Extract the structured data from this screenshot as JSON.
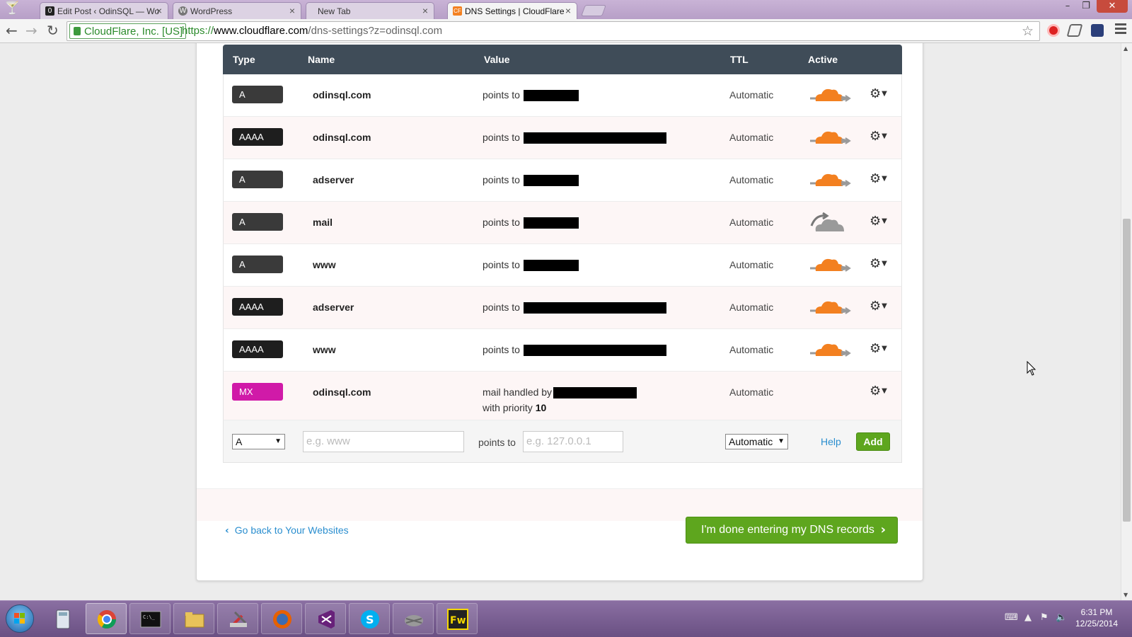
{
  "browser": {
    "tabs": [
      {
        "title": "Edit Post ‹ OdinSQL — Wo",
        "icon": "odinsql-favicon",
        "active": false
      },
      {
        "title": "WordPress",
        "icon": "wordpress-favicon",
        "active": false
      },
      {
        "title": "New Tab",
        "icon": "",
        "active": false
      },
      {
        "title": "DNS Settings | CloudFlare",
        "icon": "cloudflare-favicon",
        "active": true
      }
    ],
    "security_badge": "CloudFlare, Inc. [US]",
    "url": {
      "scheme": "https://",
      "host": "www.cloudflare.com",
      "path": "/dns-settings?z=odinsql.com"
    }
  },
  "dns": {
    "headers": {
      "type": "Type",
      "name": "Name",
      "value": "Value",
      "ttl": "TTL",
      "active": "Active"
    },
    "records": [
      {
        "type": "A",
        "name": "odinsql.com",
        "value_label": "points to",
        "ttl": "Automatic",
        "cloud": "orange",
        "redact_width": 78
      },
      {
        "type": "AAAA",
        "name": "odinsql.com",
        "value_label": "points to",
        "ttl": "Automatic",
        "cloud": "orange",
        "redact_width": 202
      },
      {
        "type": "A",
        "name": "adserver",
        "value_label": "points to",
        "ttl": "Automatic",
        "cloud": "orange",
        "redact_width": 78
      },
      {
        "type": "A",
        "name": "mail",
        "value_label": "points to",
        "ttl": "Automatic",
        "cloud": "grey",
        "redact_width": 78
      },
      {
        "type": "A",
        "name": "www",
        "value_label": "points to",
        "ttl": "Automatic",
        "cloud": "orange",
        "redact_width": 78
      },
      {
        "type": "AAAA",
        "name": "adserver",
        "value_label": "points to",
        "ttl": "Automatic",
        "cloud": "orange",
        "redact_width": 202
      },
      {
        "type": "AAAA",
        "name": "www",
        "value_label": "points to",
        "ttl": "Automatic",
        "cloud": "orange",
        "redact_width": 202
      },
      {
        "type": "MX",
        "name": "odinsql.com",
        "value_label": "mail handled by",
        "value_line2_prefix": "with priority",
        "priority": "10",
        "ttl": "Automatic",
        "cloud": "none",
        "redact_width": 118
      }
    ],
    "type_colors": {
      "A": "#3a3a3a",
      "AAAA": "#1e1e1e",
      "MX": "#d01aa8"
    },
    "add_form": {
      "type_value": "A",
      "name_placeholder": "e.g. www",
      "points_to_label": "points to",
      "value_placeholder": "e.g. 127.0.0.1",
      "ttl_value": "Automatic",
      "help_label": "Help",
      "add_label": "Add"
    }
  },
  "footer": {
    "back_link": "Go back to Your Websites",
    "done_button": "I'm done entering my DNS records"
  },
  "taskbar": {
    "apps": [
      "calculator",
      "chrome",
      "command-prompt",
      "file-explorer",
      "tools",
      "firefox",
      "visual-studio",
      "skype",
      "network-tool",
      "fireworks"
    ],
    "clock_time": "6:31 PM",
    "clock_date": "12/25/2014"
  },
  "colors": {
    "cloudflare_orange": "#f38020",
    "green_button": "#5ea61e",
    "link_blue": "#2a8ecf",
    "header_dark": "#3f4c58"
  }
}
